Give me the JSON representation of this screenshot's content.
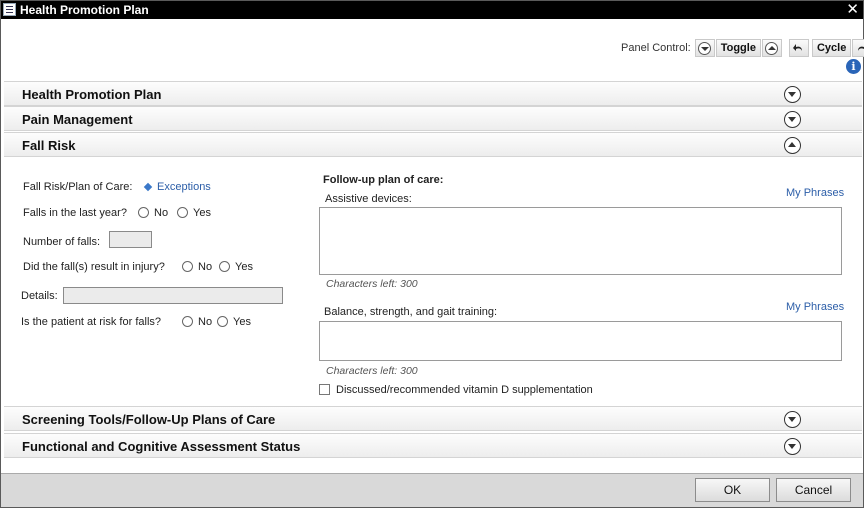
{
  "window": {
    "title": "Health Promotion Plan",
    "close_glyph": "✕"
  },
  "panel_control": {
    "label": "Panel Control:",
    "toggle": "Toggle",
    "cycle": "Cycle"
  },
  "sections": {
    "health_promotion": "Health Promotion Plan",
    "pain_management": "Pain Management",
    "fall_risk": "Fall Risk",
    "screening_tools": "Screening Tools/Follow-Up Plans of Care",
    "functional_status": "Functional and Cognitive Assessment Status"
  },
  "fall_risk": {
    "plan_label": "Fall Risk/Plan of Care:",
    "exceptions_link": "Exceptions",
    "falls_last_year": {
      "label": "Falls in the last year?",
      "no": "No",
      "yes": "Yes"
    },
    "number_of_falls": {
      "label": "Number of falls:",
      "value": ""
    },
    "injury": {
      "label": "Did the fall(s) result in injury?",
      "no": "No",
      "yes": "Yes"
    },
    "details": {
      "label": "Details:",
      "value": ""
    },
    "at_risk": {
      "label": "Is the patient at risk for falls?",
      "no": "No",
      "yes": "Yes"
    }
  },
  "followup": {
    "heading": "Follow-up plan of care:",
    "my_phrases_1": "My Phrases",
    "assistive_label": "Assistive devices:",
    "assistive_value": "",
    "chars_left_1": "Characters left: 300",
    "my_phrases_2": "My Phrases",
    "balance_label": "Balance, strength, and gait training:",
    "balance_value": "",
    "chars_left_2": "Characters left: 300",
    "vitamin_d_label": "Discussed/recommended vitamin D supplementation"
  },
  "footer": {
    "ok": "OK",
    "cancel": "Cancel"
  },
  "icons": [
    "app-icon",
    "close-icon",
    "toggle-down-icon",
    "toggle-up-icon",
    "undo-icon",
    "refresh-icon",
    "info-icon",
    "collapse-icon",
    "expand-icon",
    "diamond-icon"
  ]
}
